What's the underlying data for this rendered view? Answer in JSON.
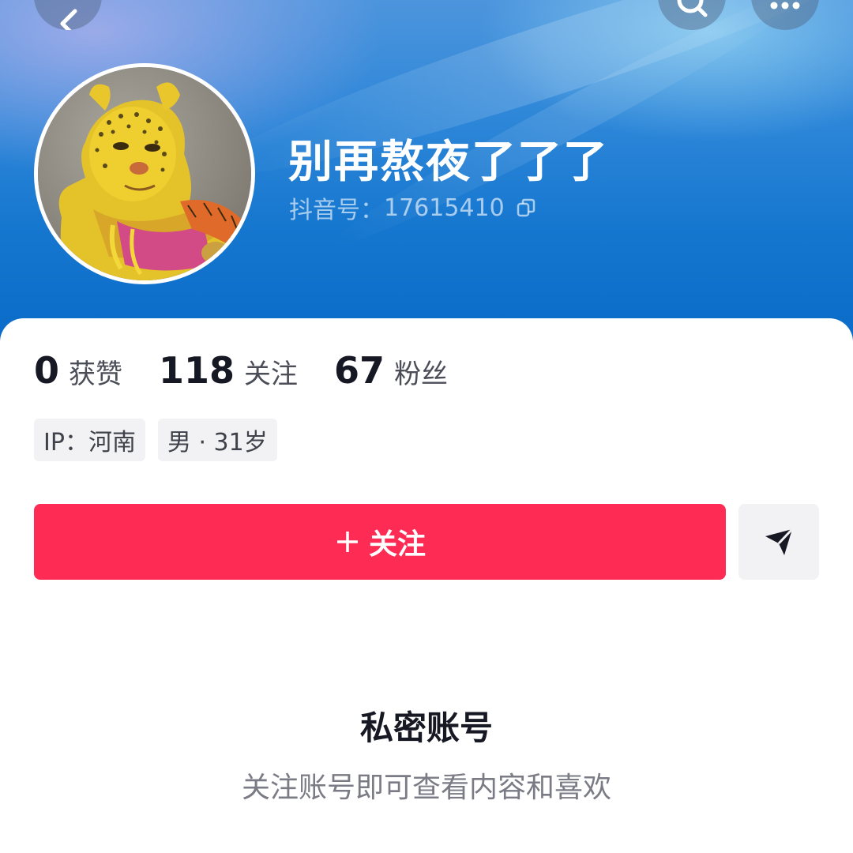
{
  "header": {
    "back_icon": "chevron-left-icon",
    "search_icon": "search-icon",
    "more_icon": "more-dots-icon"
  },
  "profile": {
    "avatar": "leopard-costume-avatar",
    "nickname": "别再熬夜了了了",
    "id_label": "抖音号：",
    "id_value": "17615410",
    "copy_icon": "copy-icon"
  },
  "stats": [
    {
      "value": "0",
      "label": "获赞"
    },
    {
      "value": "118",
      "label": "关注"
    },
    {
      "value": "67",
      "label": "粉丝"
    }
  ],
  "tags": [
    {
      "text": "IP：河南"
    },
    {
      "text": "男 · 31岁"
    }
  ],
  "actions": {
    "follow_label": "关注",
    "follow_icon": "plus-icon",
    "share_icon": "send-icon"
  },
  "private": {
    "title": "私密账号",
    "description": "关注账号即可查看内容和喜欢"
  },
  "colors": {
    "accent": "#fe2c55",
    "banner": "#1677cf",
    "text_primary": "#161823",
    "text_secondary": "#7a7b84"
  }
}
